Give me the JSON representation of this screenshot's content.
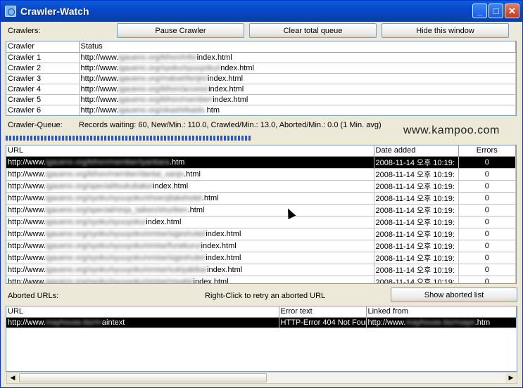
{
  "window": {
    "title": "Crawler-Watch",
    "minimize": "_",
    "maximize": "□",
    "close": "✕"
  },
  "crawlers_section": {
    "label": "Crawlers:",
    "buttons": {
      "pause": "Pause Crawler",
      "clear": "Clear total queue",
      "hide": "Hide this window"
    },
    "columns": [
      "Crawler",
      "Status"
    ],
    "rows": [
      {
        "name": "Crawler 1",
        "status_prefix": "http://www.",
        "status_blur": "igaueno.org/kihon/info/",
        "status_suffix": "index.html"
      },
      {
        "name": "Crawler 2",
        "status_prefix": "http://www.",
        "status_blur": "igaueno.org/syoku/syuuyoku/i",
        "status_suffix": "ndex.html"
      },
      {
        "name": "Crawler 3",
        "status_prefix": "http://www.",
        "status_blur": "igaueno.org/matuei/tenjin/",
        "status_suffix": "index.html"
      },
      {
        "name": "Crawler 4",
        "status_prefix": "http://www.",
        "status_blur": "igaueno.org/kihon/access/",
        "status_suffix": "index.html"
      },
      {
        "name": "Crawler 5",
        "status_prefix": "http://www.",
        "status_blur": "igaueno.org/kihon/member/",
        "status_suffix": "index.html"
      },
      {
        "name": "Crawler 6",
        "status_prefix": "http://www.",
        "status_blur": "igaueno.org/okashi/kaido.",
        "status_suffix": "htm"
      }
    ]
  },
  "queue_section": {
    "label": "Crawler-Queue:",
    "stats": "Records waiting: 60, New/Min.: 110.0, Crawled/Min.: 13.0, Aborted/Min.: 0.0 (1 Min. avg)",
    "watermark": "www.kampoo.com",
    "columns": [
      "URL",
      "Date added",
      "Errors"
    ],
    "rows": [
      {
        "url_prefix": "http://www.",
        "url_blur": "igaueno.org/kihon/member/iyanbara",
        "url_suffix": ".htm",
        "date": "2008-11-14 오후 10:19:",
        "errors": "0",
        "selected": true
      },
      {
        "url_prefix": "http://www.",
        "url_blur": "igaueno.org/kihon/member/dantai_sanjo",
        "url_suffix": ".html",
        "date": "2008-11-14 오후 10:19:",
        "errors": "0"
      },
      {
        "url_prefix": "http://www.",
        "url_blur": "igaueno.org/special/toukubako/",
        "url_suffix": "index.html",
        "date": "2008-11-14 오후 10:19:",
        "errors": "0"
      },
      {
        "url_prefix": "http://www.",
        "url_blur": "igaueno.org/syoku/syuuyoku/shoenjitakehotel",
        "url_suffix": ".html",
        "date": "2008-11-14 오후 10:19:",
        "errors": "0"
      },
      {
        "url_prefix": "http://www.",
        "url_blur": "igaueno.org/special/ninja_taiken/shuriken",
        "url_suffix": ".html",
        "date": "2008-11-14 오후 10:19:",
        "errors": "0"
      },
      {
        "url_prefix": "http://www.",
        "url_blur": "igaueno.org/syoku/syuuyoku/",
        "url_suffix": "index.html",
        "date": "2008-11-14 오후 10:19:",
        "errors": "0"
      },
      {
        "url_prefix": "http://www.",
        "url_blur": "igaueno.org/syoku/syuuyoku/omise/sigeshutei/",
        "url_suffix": "index.html",
        "date": "2008-11-14 오후 10:19:",
        "errors": "0"
      },
      {
        "url_prefix": "http://www.",
        "url_blur": "igaueno.org/syoku/syuuyoku/omise/funekuru/",
        "url_suffix": "index.html",
        "date": "2008-11-14 오후 10:19:",
        "errors": "0"
      },
      {
        "url_prefix": "http://www.",
        "url_blur": "igaueno.org/syoku/syuuyoku/omise/sigeshutei/",
        "url_suffix": "index.html",
        "date": "2008-11-14 오후 10:19:",
        "errors": "0"
      },
      {
        "url_prefix": "http://www.",
        "url_blur": "igaueno.org/syoku/syuuyoku/omise/sukiyakiba/",
        "url_suffix": "index.html",
        "date": "2008-11-14 오후 10:19:",
        "errors": "0"
      },
      {
        "url_prefix": "http://www.",
        "url_blur": "igaueno.org/syoku/syuuyoku/omise/miyabi/",
        "url_suffix": "index.html",
        "date": "2008-11-14 오후 10:19:",
        "errors": "0"
      },
      {
        "url_prefix": "http://www.",
        "url_blur": "igaueno.org/special/ninja_syoku/recipe/57/57",
        "url_suffix": ".htm",
        "date": "2008-11-14 오후 10:19:",
        "errors": "0"
      }
    ]
  },
  "aborted_section": {
    "label": "Aborted URLs:",
    "hint": "Right-Click to retry an aborted URL",
    "show_button": "Show aborted list",
    "columns": [
      "URL",
      "Error text",
      "Linked from"
    ],
    "rows": [
      {
        "url_prefix": "http://www.",
        "url_blur": "mayhouse.biz/m",
        "url_suffix": "aintext",
        "error": "HTTP-Error 404 Not Four",
        "linked_prefix": "http://www.",
        "linked_blur": "mayhouse.biz/roayo",
        "linked_suffix": ".htm",
        "selected": true
      }
    ]
  },
  "scrollbar": {
    "left_arrow": "◀",
    "right_arrow": "▶"
  }
}
